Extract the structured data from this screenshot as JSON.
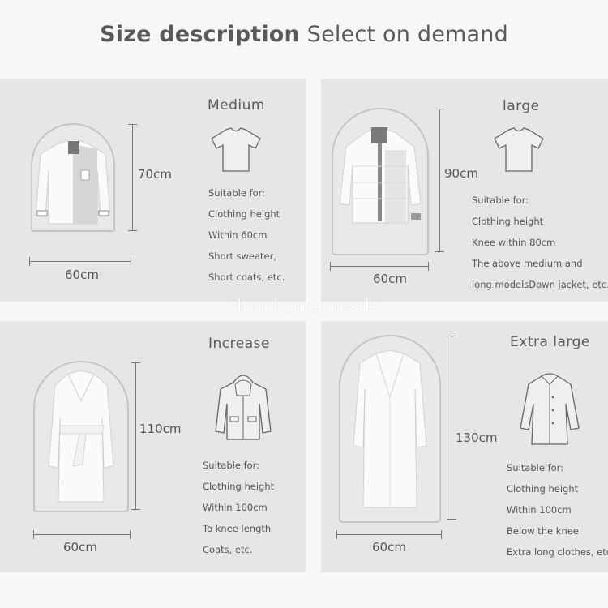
{
  "header": {
    "title_bold": "Size description",
    "title_light": "Select on demand"
  },
  "watermark": "shumi-cn.en.made",
  "panels": [
    {
      "name": "Medium",
      "height": "70cm",
      "width": "60cm",
      "lines": [
        "Suitable for:",
        "Clothing height",
        "Within 60cm",
        "Short sweater,",
        "Short coats, etc."
      ],
      "garment_icon": "tshirt-icon",
      "bag_garment": "shirt-icon"
    },
    {
      "name": "large",
      "height": "90cm",
      "width": "60cm",
      "lines": [
        "Suitable for:",
        "Clothing height",
        "Knee within 80cm",
        "The above medium and",
        " long modelsDown jacket, etc."
      ],
      "garment_icon": "tshirt-icon",
      "bag_garment": "down-jacket-icon"
    },
    {
      "name": "Increase",
      "height": "110cm",
      "width": "60cm",
      "lines": [
        "Suitable for:",
        "Clothing height",
        "Within 100cm",
        "To knee length",
        "Coats, etc."
      ],
      "garment_icon": "hoodie-icon",
      "bag_garment": "trench-coat-icon"
    },
    {
      "name": "Extra large",
      "height": "130cm",
      "width": "60cm",
      "lines": [
        "Suitable for:",
        "Clothing height",
        "Within 100cm",
        "Below the knee",
        "Extra long clothes, etc."
      ],
      "garment_icon": "long-coat-icon",
      "bag_garment": "long-overcoat-icon"
    }
  ]
}
